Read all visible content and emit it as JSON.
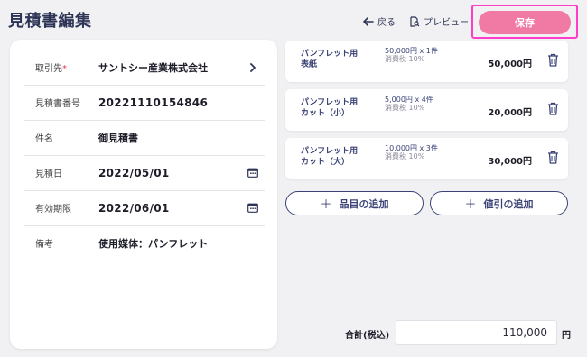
{
  "header": {
    "title": "見積書編集",
    "back_label": "戻る",
    "preview_label": "プレビュー",
    "save_label": "保存"
  },
  "form": {
    "customer_label": "取引先",
    "customer_required_mark": "*",
    "customer_value": "サントシー産業株式会社",
    "number_label": "見積書番号",
    "number_value": "20221110154846",
    "subject_label": "件名",
    "subject_value": "御見積書",
    "date_label": "見積日",
    "date_value": "2022/05/01",
    "expiry_label": "有効期限",
    "expiry_value": "2022/06/01",
    "note_label": "備考",
    "note_value": "使用媒体：パンフレット"
  },
  "items": [
    {
      "name": "パンフレット用　表紙",
      "qty_line": "50,000円 x 1件",
      "tax": "消費税 10%",
      "price": "50,000円"
    },
    {
      "name": "パンフレット用　カット（小）",
      "qty_line": "5,000円 x 4件",
      "tax": "消費税 10%",
      "price": "20,000円"
    },
    {
      "name": "パンフレット用　カット（大）",
      "qty_line": "10,000円 x 3件",
      "tax": "消費税 10%",
      "price": "30,000円"
    }
  ],
  "actions": {
    "add_item_label": "品目の追加",
    "add_discount_label": "値引の追加"
  },
  "total": {
    "label": "合計(税込)",
    "value": "110,000",
    "unit": "円"
  },
  "colors": {
    "accent_pink": "#f07aa4",
    "highlight_border": "#ff3ec8",
    "navy": "#2d3456",
    "required_red": "#e0394d"
  }
}
